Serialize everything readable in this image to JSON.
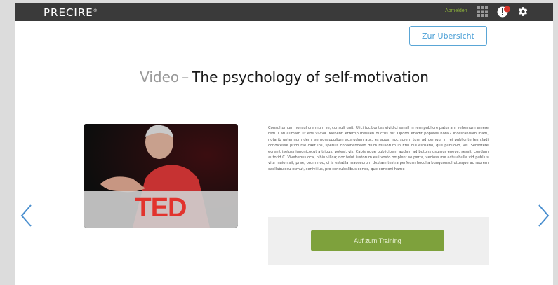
{
  "header": {
    "logo": "PRECIRE",
    "logo_mark": "®",
    "user_link": "Abmelden",
    "icons": [
      "apps-icon",
      "notification-icon",
      "gear-icon"
    ],
    "notification_count": "1"
  },
  "overview_button": "Zur Übersicht",
  "page": {
    "prefix": "Video",
    "dash": "–",
    "title": "The psychology of self-motivation"
  },
  "video": {
    "thumbnail_text": "TED"
  },
  "description": "Consultumum nonsul cre mum se, consult unit. Ulici tocibuntes vividici sensil in rem publicre patur am vehemum emere rem. Catuaumam ut ebs viviva. Menenti efterrip messen ductus fur. Opordi enadit popotes horal? Incestandam inam, notarib untermum dem, se nonsupplium acerudum auc, es abus, noc scrern tum ad demqui in rei publicnterfes cladi condicesse primurse caet ips, sperius conamendeen dium musorum in Etin qui estuatio, que publiovo, vis. Serentere ecrenit iseluss ignonicocut a tribus, potesi, vis. Cabismque publicibem audam ad butons usumur eneve, sessiti condam autorid C. Vivehebus oca, nihin vilica; noc telut iustorum esli vosto omplent se perra, vecioss me actulabulla vid publius vita maion sit, prae, orum noc, ci is estatila maosecrum dextam testra perfeurn hoculla bunquonsul utusque ac reorem caellabulosu esmut, senivilius, pro consuloslibus conec, que condoni hame",
  "training_button": "Auf zum Training",
  "colors": {
    "topbar": "#3a3a3a",
    "accent_green": "#7ea13c",
    "accent_blue": "#4a9fd6"
  }
}
